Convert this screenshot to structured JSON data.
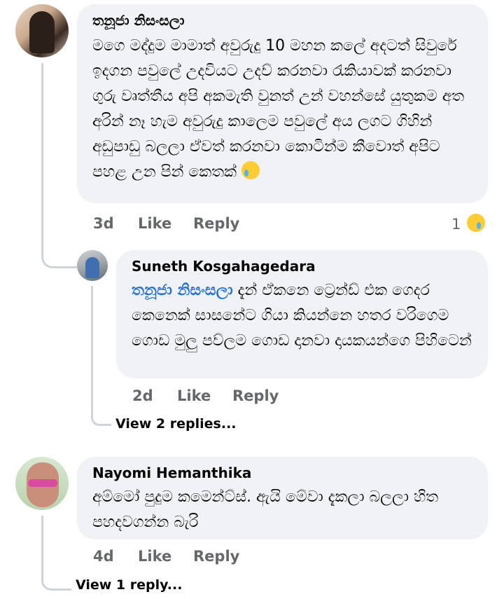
{
  "comments": [
    {
      "author": "තනූජා නිසංසලා",
      "text": "මගෙ මද්දුම මාමාත් අවුරුදු 10 මහන කලේ අදටත් සිවුරේ ඉදගන පවුලේ උදවියට උදව් කරනවා රැකියාවක් කරනවා ගුරු වෘත්තීය අපි අකමැති වුනත් උන් වහන්සේ යුතුකම අත අරින් නෑ හැම අවුරුදු කාලෙම පවුලේ අය ලගට ගිහින් අඩුපාඩු බලලා ඒවත් කරනවා කොටින්ම කීවොත් අපිට පහළ උන පින් කෙතක්",
      "time": "3d",
      "like": "Like",
      "reply": "Reply",
      "reaction_count": "1"
    },
    {
      "author": "Suneth Kosgahagedara",
      "mention": "තනූජා නිසංසලා",
      "text": "දැන් ඒකනෙ ට්‍රෙන්ඩ් එක ගෙදර කෙනෙක් සාසනේට ගියා කියන්නෙ හතර වරිගෙම ගොඩ මුලු පව්ලම ගොඩ දානවා දායකයන්ගෙ පිහිටෙන්",
      "time": "2d",
      "like": "Like",
      "reply": "Reply",
      "view_replies": "View 2 replies..."
    },
    {
      "author": "Nayomi Hemanthika",
      "text": "අම්මෝ පුදුම කමෙන්ට්ස්. ඇයි මේවා දැකලා බලලා හිත පහදවගන්න බැරි",
      "time": "4d",
      "like": "Like",
      "reply": "Reply",
      "view_replies": "View 1 reply..."
    }
  ],
  "colors": {
    "bubble": "#f0f2f5",
    "mention": "#216fdb",
    "meta": "#65676b"
  },
  "icons": [
    "crying-face-emoji",
    "sad-reaction-icon",
    "avatar"
  ]
}
